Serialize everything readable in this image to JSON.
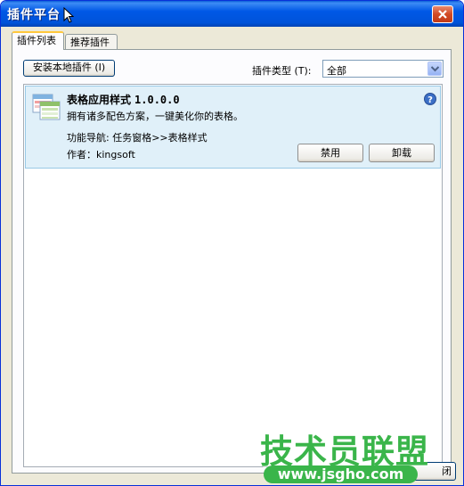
{
  "window": {
    "title": "插件平台"
  },
  "tabs": [
    {
      "label": "插件列表",
      "active": true
    },
    {
      "label": "推荐插件",
      "active": false
    }
  ],
  "toolbar": {
    "install_label": "安装本地插件 (I)",
    "type_label": "插件类型 (T):",
    "type_value": "全部"
  },
  "plugin": {
    "name": "表格应用样式",
    "version": "1.0.0.0",
    "description": "拥有诸多配色方案，一键美化你的表格。",
    "nav": "功能导航: 任务窗格>>表格样式",
    "author": "作者：kingsoft",
    "disable_label": "禁用",
    "uninstall_label": "卸载"
  },
  "footer": {
    "close_label": "闭"
  },
  "watermark": {
    "text": "技术员联盟",
    "url": "www.jsgho.com"
  },
  "colors": {
    "titlebar": "#0058e6",
    "card_bg": "#e0f0f9",
    "watermark": "#3ab54a"
  },
  "icons": [
    "close-icon",
    "dropdown-arrow-icon",
    "plugin-table-icon",
    "help-icon",
    "mouse-cursor-icon"
  ]
}
